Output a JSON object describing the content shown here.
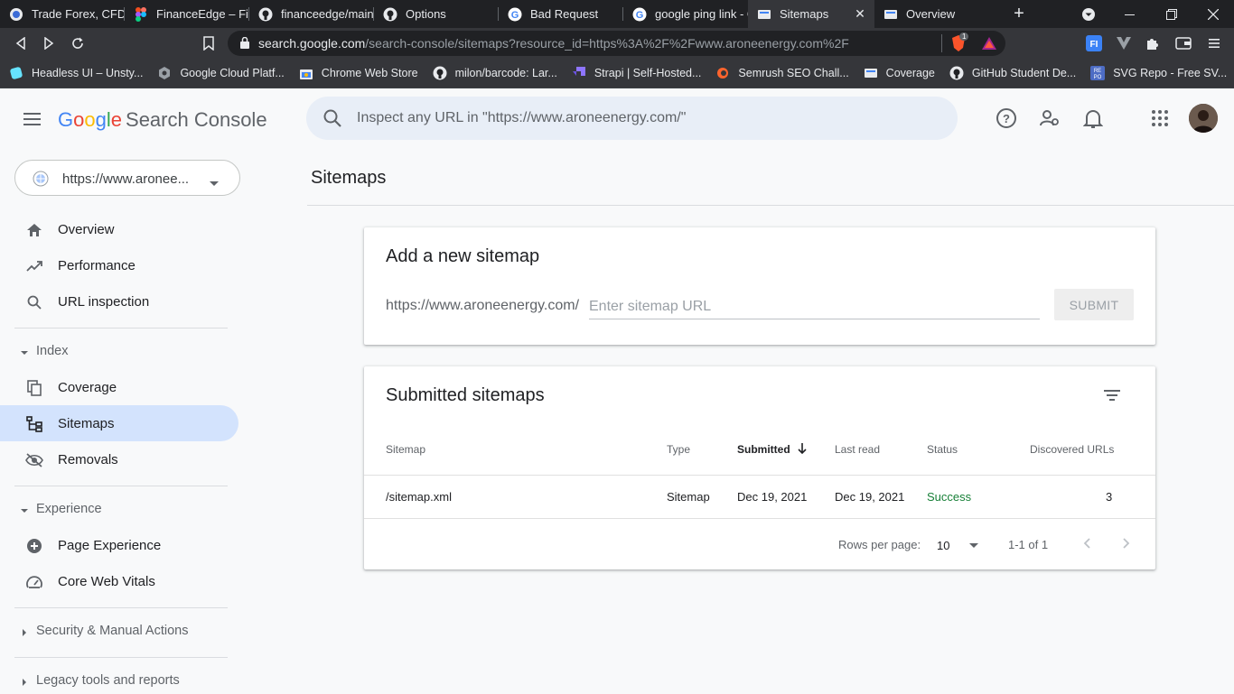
{
  "browser": {
    "tabs": [
      {
        "title": "Trade Forex, CFDs a",
        "icon": "forex-icon"
      },
      {
        "title": "FinanceEdge – Figm",
        "icon": "figma-icon"
      },
      {
        "title": "financeedge/main.c",
        "icon": "github-icon"
      },
      {
        "title": "Options",
        "icon": "github-icon"
      },
      {
        "title": "Bad Request",
        "icon": "google-icon"
      },
      {
        "title": "google ping link - G",
        "icon": "google-icon"
      },
      {
        "title": "Sitemaps",
        "icon": "search-console-icon",
        "active": true
      },
      {
        "title": "Overview",
        "icon": "search-console-icon"
      }
    ],
    "url_host": "search.google.com",
    "url_path": "/search-console/sitemaps?resource_id=https%3A%2F%2Fwww.aroneenergy.com%2F",
    "brave_badge": "1",
    "bookmarks": [
      {
        "label": "Headless UI – Unsty...",
        "icon": "headlessui-icon"
      },
      {
        "label": "Google Cloud Platf...",
        "icon": "gcp-icon"
      },
      {
        "label": "Chrome Web Store",
        "icon": "webstore-icon"
      },
      {
        "label": "milon/barcode: Lar...",
        "icon": "github-icon"
      },
      {
        "label": "Strapi | Self-Hosted...",
        "icon": "strapi-icon"
      },
      {
        "label": "Semrush SEO Chall...",
        "icon": "semrush-icon"
      },
      {
        "label": "Coverage",
        "icon": "search-console-icon"
      },
      {
        "label": "GitHub Student De...",
        "icon": "github-icon"
      },
      {
        "label": "SVG Repo - Free SV...",
        "icon": "svgrepo-icon"
      }
    ]
  },
  "header": {
    "logo_google": "Google",
    "logo_product": "Search Console",
    "search_placeholder": "Inspect any URL in \"https://www.aroneenergy.com/\""
  },
  "sidebar": {
    "property": "https://www.aronee...",
    "items": [
      {
        "label": "Overview"
      },
      {
        "label": "Performance"
      },
      {
        "label": "URL inspection"
      }
    ],
    "index_label": "Index",
    "index_items": [
      {
        "label": "Coverage"
      },
      {
        "label": "Sitemaps",
        "active": true
      },
      {
        "label": "Removals"
      }
    ],
    "experience_label": "Experience",
    "experience_items": [
      {
        "label": "Page Experience"
      },
      {
        "label": "Core Web Vitals"
      }
    ],
    "security_label": "Security & Manual Actions",
    "legacy_label": "Legacy tools and reports"
  },
  "main": {
    "title": "Sitemaps",
    "add_card": {
      "title": "Add a new sitemap",
      "prefix": "https://www.aroneenergy.com/",
      "placeholder": "Enter sitemap URL",
      "submit_label": "SUBMIT"
    },
    "submitted": {
      "title": "Submitted sitemaps",
      "columns": [
        "Sitemap",
        "Type",
        "Submitted",
        "Last read",
        "Status",
        "Discovered URLs"
      ],
      "rows": [
        {
          "sitemap": "/sitemap.xml",
          "type": "Sitemap",
          "submitted": "Dec 19, 2021",
          "last_read": "Dec 19, 2021",
          "status": "Success",
          "discovered": "3"
        }
      ],
      "rows_per_page_label": "Rows per page:",
      "rows_per_page": "10",
      "range": "1-1 of 1"
    }
  },
  "colors": {
    "accent_active": "#d3e3fd",
    "success": "#188038"
  }
}
